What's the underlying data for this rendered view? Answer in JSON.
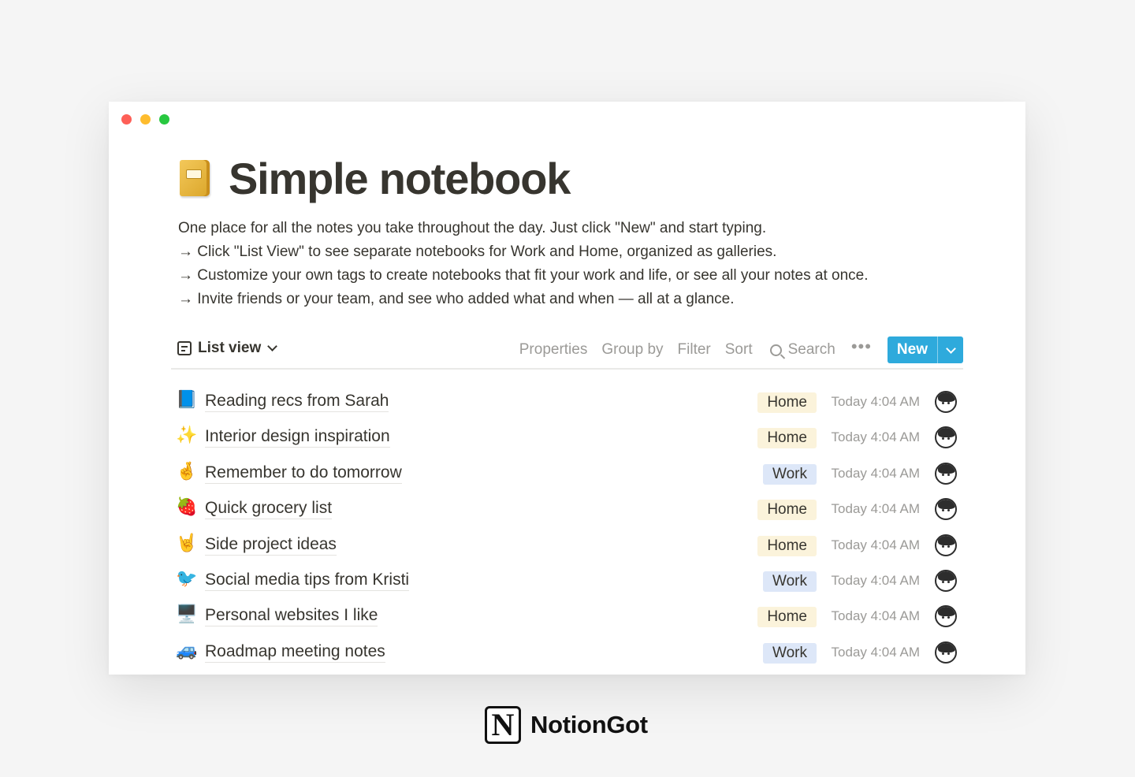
{
  "page": {
    "title": "Simple notebook",
    "icon": "notebook-icon",
    "description": [
      "One place for all the notes you take throughout the day. Just click \"New\" and start typing.",
      "→ Click \"List View\" to see separate notebooks for Work and Home, organized as galleries.",
      "→ Customize your own tags to create notebooks that fit your work and life, or see all your notes at once.",
      "→ Invite friends or your team, and see who added what and when — all at a glance."
    ]
  },
  "toolbar": {
    "view_label": "List view",
    "properties": "Properties",
    "group_by": "Group by",
    "filter": "Filter",
    "sort": "Sort",
    "search": "Search",
    "more": "•••",
    "new_label": "New"
  },
  "rows": [
    {
      "icon": "📘",
      "title": "Reading recs from Sarah",
      "tag": "Home",
      "time": "Today 4:04 AM"
    },
    {
      "icon": "✨",
      "title": "Interior design inspiration",
      "tag": "Home",
      "time": "Today 4:04 AM"
    },
    {
      "icon": "🤞",
      "title": "Remember to do tomorrow",
      "tag": "Work",
      "time": "Today 4:04 AM"
    },
    {
      "icon": "🍓",
      "title": "Quick grocery list",
      "tag": "Home",
      "time": "Today 4:04 AM"
    },
    {
      "icon": "🤘",
      "title": "Side project ideas",
      "tag": "Home",
      "time": "Today 4:04 AM"
    },
    {
      "icon": "🐦",
      "title": "Social media tips from Kristi",
      "tag": "Work",
      "time": "Today 4:04 AM"
    },
    {
      "icon": "🖥️",
      "title": "Personal websites I like",
      "tag": "Home",
      "time": "Today 4:04 AM"
    },
    {
      "icon": "🚙",
      "title": "Roadmap meeting notes",
      "tag": "Work",
      "time": "Today 4:04 AM"
    }
  ],
  "brand": {
    "logo_letter": "N",
    "name": "NotionGot"
  },
  "colors": {
    "accent": "#2eaadc",
    "tag_home": "#fbf3db",
    "tag_work": "#dde7f8",
    "text": "#37352f",
    "muted": "#9b9a97"
  }
}
